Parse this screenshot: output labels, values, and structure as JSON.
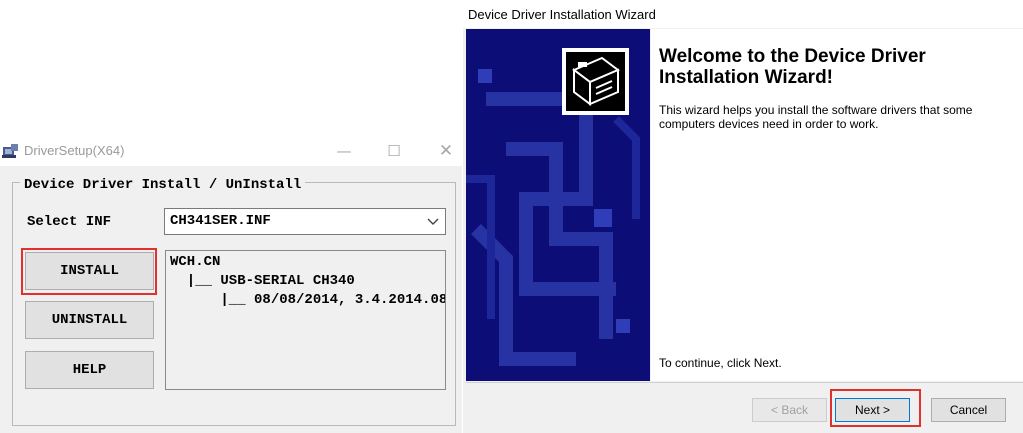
{
  "driver_setup": {
    "window_title": "DriverSetup(X64)",
    "controls": {
      "minimize": "—",
      "maximize": "☐",
      "close": "✕"
    },
    "group_label": "Device Driver Install / UnInstall",
    "select_inf_label": "Select INF",
    "inf_selected": "CH341SER.INF",
    "buttons": {
      "install": "INSTALL",
      "uninstall": "UNINSTALL",
      "help": "HELP"
    },
    "info_lines": [
      "WCH.CN",
      "  |__ USB-SERIAL CH340",
      "      |__ 08/08/2014, 3.4.2014.08"
    ],
    "icons": {
      "app": "driver-setup-icon",
      "dropdown": "chevron-down-icon"
    },
    "highlight_color": "#e0312e"
  },
  "wizard": {
    "window_title": "Device Driver Installation Wizard",
    "heading": "Welcome to the Device Driver Installation Wizard!",
    "description": "This wizard helps you install the software drivers that some computers devices need in order to work.",
    "continue_text": "To continue, click Next.",
    "buttons": {
      "back": "< Back",
      "next": "Next >",
      "cancel": "Cancel"
    },
    "icons": {
      "banner": "hardware-box-icon"
    },
    "banner_color": "#0d0d78",
    "highlight_color": "#e0312e"
  }
}
